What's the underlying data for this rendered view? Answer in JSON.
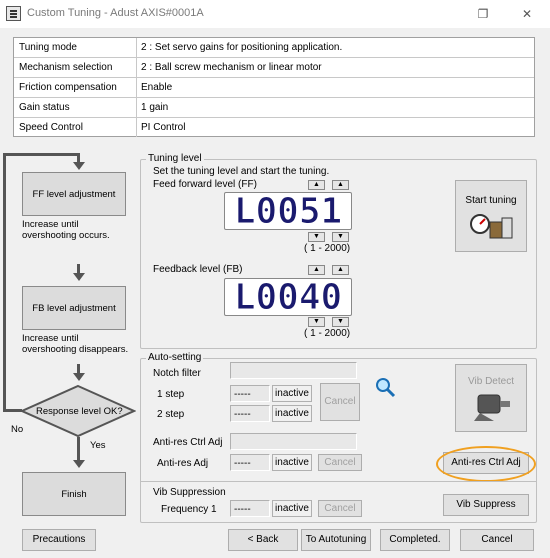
{
  "window": {
    "title": "Custom Tuning - Adust AXIS#0001A",
    "restore_glyph": "❐",
    "close_glyph": "✕"
  },
  "info": {
    "rows": [
      {
        "label": "Tuning mode",
        "value": "2 : Set servo gains for positioning application."
      },
      {
        "label": "Mechanism selection",
        "value": "2 : Ball screw mechanism or linear motor"
      },
      {
        "label": "Friction compensation",
        "value": "Enable"
      },
      {
        "label": "Gain status",
        "value": "1 gain"
      },
      {
        "label": "Speed Control",
        "value": "PI Control"
      }
    ]
  },
  "flow": {
    "ff_box": "FF level adjustment",
    "ff_note1": "Increase until",
    "ff_note2": "overshooting occurs.",
    "fb_box": "FB level adjustment",
    "fb_note1": "Increase until",
    "fb_note2": "overshooting disappears.",
    "decision": "Response level OK?",
    "no": "No",
    "yes": "Yes",
    "finish": "Finish"
  },
  "tuning_level": {
    "title": "Tuning level",
    "instruction": "Set the tuning level and start the tuning.",
    "ff_label": "Feed forward level (FF)",
    "ff_display": "L0051",
    "ff_range": "( 1 - 2000)",
    "fb_label": "Feedback level (FB)",
    "fb_display": "L0040",
    "fb_range": "( 1 - 2000)",
    "start_label": "Start tuning",
    "up": "▲",
    "down": "▼"
  },
  "auto_setting": {
    "title": "Auto-setting",
    "notch_label": "Notch filter",
    "step1": "1 step",
    "step2": "2 step",
    "dashes": "-----",
    "inactive": "inactive",
    "cancel": "Cancel",
    "vib_detect": "Vib Detect",
    "antires_ctrl_label": "Anti-res Ctrl Adj",
    "antires_label": "Anti-res Adj",
    "antires_button": "Anti-res Ctrl Adj",
    "vib_supp_label": "Vib Suppression",
    "freq1": "Frequency 1",
    "vib_button": "Vib Suppress"
  },
  "footer": {
    "precautions": "Precautions",
    "back": "< Back",
    "to_autotuning": "To Autotuning",
    "completed": "Completed.",
    "cancel": "Cancel"
  },
  "colors": {
    "highlight_ring": "#f0a020",
    "display_digits": "#1a1a6e"
  }
}
